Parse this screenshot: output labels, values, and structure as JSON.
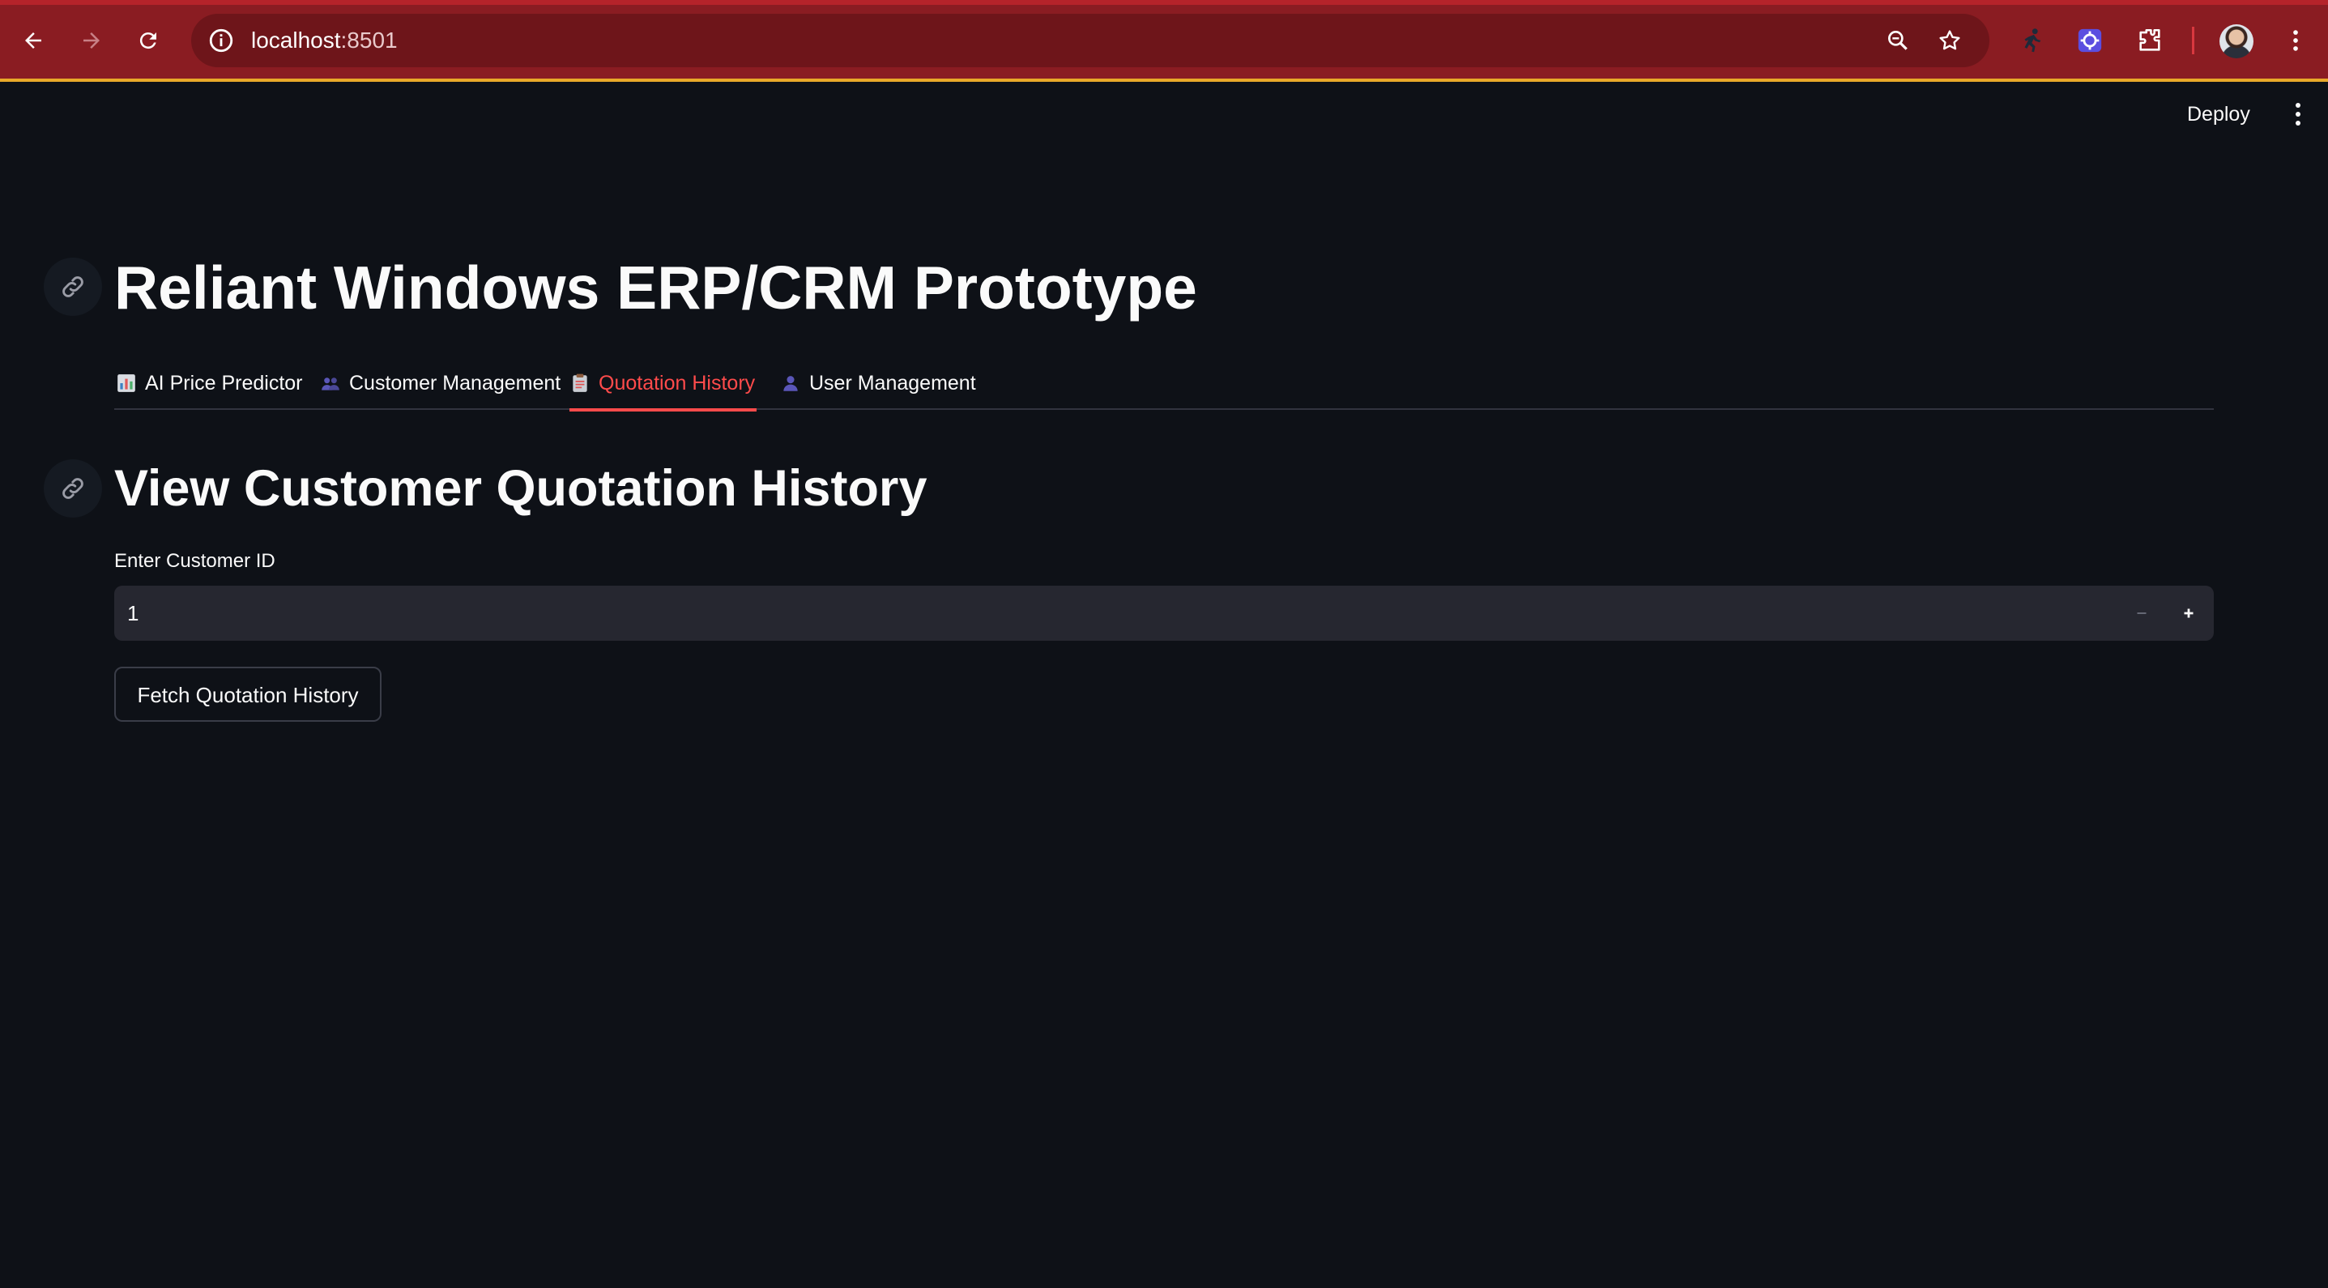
{
  "browser": {
    "url_host": "localhost",
    "url_port": ":8501"
  },
  "app_header": {
    "deploy_label": "Deploy"
  },
  "page": {
    "title": "Reliant Windows ERP/CRM Prototype",
    "tabs": [
      {
        "label": "AI Price Predictor",
        "icon": "bar-chart-icon",
        "active": false
      },
      {
        "label": "Customer Management",
        "icon": "people-icon",
        "active": false
      },
      {
        "label": "Quotation History",
        "icon": "clipboard-icon",
        "active": true
      },
      {
        "label": "User Management",
        "icon": "person-icon",
        "active": false
      }
    ],
    "section_title": "View Customer Quotation History",
    "customer_id_label": "Enter Customer ID",
    "customer_id_value": "1",
    "fetch_button_label": "Fetch Quotation History"
  },
  "colors": {
    "accent": "#ff4b4b",
    "background": "#0e1117",
    "input_bg": "#262730",
    "browser_bar": "#8a1c22"
  }
}
